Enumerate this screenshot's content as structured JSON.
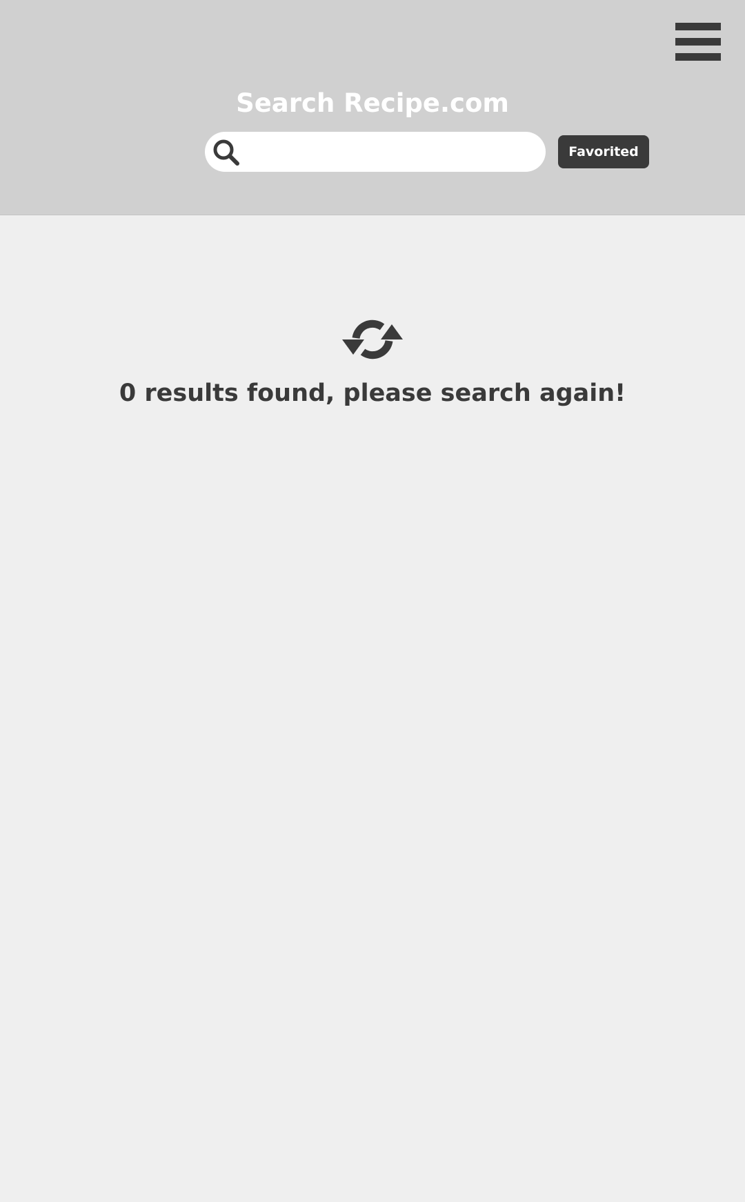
{
  "header": {
    "site_title": "Search Recipe.com",
    "menu_icon": "hamburger-menu-icon",
    "search": {
      "icon": "search-icon",
      "value": "",
      "placeholder": ""
    },
    "favorited_label": "Favorited"
  },
  "results": {
    "icon": "refresh-icon",
    "count": 0,
    "message": "0 results found, please search again!"
  },
  "colors": {
    "header_bg": "#d0d0d0",
    "page_bg": "#efefef",
    "dark": "#3a3a3a",
    "white": "#ffffff"
  }
}
